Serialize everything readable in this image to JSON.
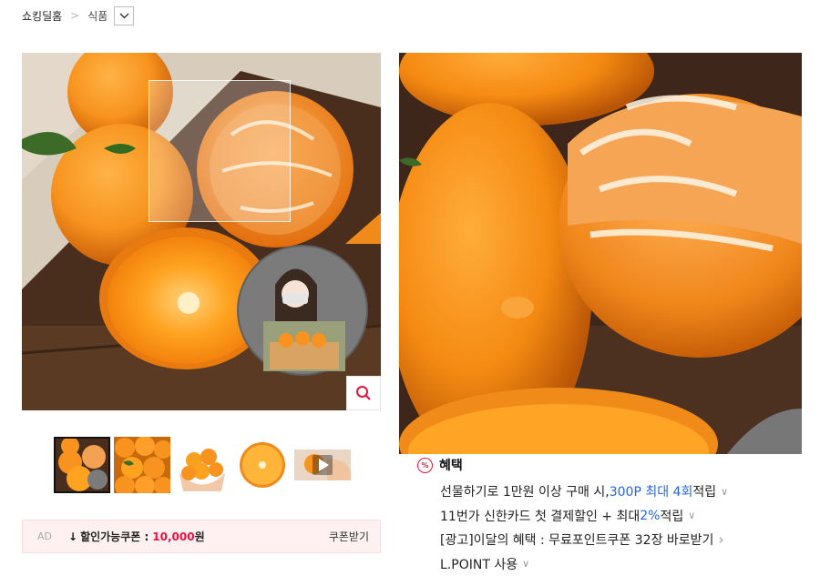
{
  "breadcrumb": {
    "home": "쇼킹딜홈",
    "category": "식품"
  },
  "icons": {
    "chevron_right": "chevron-right-icon",
    "dropdown": "chevron-down-icon",
    "zoom": "search-icon",
    "play": "play-icon",
    "percent": "percent-badge-icon"
  },
  "thumbnails": [
    {
      "name": "tangerines-with-farmer"
    },
    {
      "name": "tangerine-pile"
    },
    {
      "name": "tangerines-in-hands"
    },
    {
      "name": "tangerine-half"
    },
    {
      "name": "video-thumbnail"
    }
  ],
  "coupon": {
    "ad": "AD",
    "arrow": "↓",
    "label": "할인가능쿠폰 :",
    "amount": "10,000",
    "unit": "원",
    "button": "쿠폰받기"
  },
  "benefits": {
    "title": "혜택",
    "badge": "%",
    "rows": [
      {
        "pre": "선물하기로 1만원 이상 구매 시, ",
        "hl": "300P 최대 4회",
        "post": " 적립",
        "chev": "∨"
      },
      {
        "pre": "11번가 신한카드 첫 결제할인 + 최대 ",
        "hl": "2%",
        "post": " 적립",
        "chev": "∨"
      },
      {
        "pre": "[광고]이달의 혜택 : 무료포인트쿠폰 32장 바로받기",
        "hl": "",
        "post": "",
        "chev": "›"
      },
      {
        "pre": "L.POINT 사용",
        "hl": "",
        "post": "",
        "chev": "∨"
      }
    ]
  },
  "colors": {
    "accent_red": "#e8123c",
    "link_blue": "#2466e6",
    "tangerine": "#f7931e",
    "coupon_bg": "#fff1f1"
  }
}
